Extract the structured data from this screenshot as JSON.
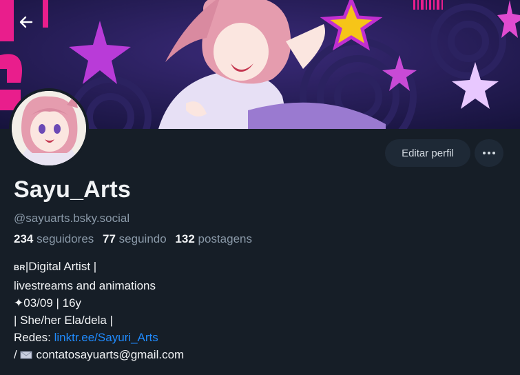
{
  "profile": {
    "display_name": "Sayu_Arts",
    "handle": "@sayuarts.bsky.social",
    "stats": {
      "followers_count": "234",
      "followers_label": "seguidores",
      "following_count": "77",
      "following_label": "seguindo",
      "posts_count": "132",
      "posts_label": "postagens"
    },
    "bio": {
      "line1_flag": "BR",
      "line1_text": "|Digital Artist |",
      "line2": "livestreams and animations",
      "line3": "✦03/09 | 16y",
      "line4": "| She/her Ela/dela |",
      "line5_label": "Redes: ",
      "line5_link": "linktr.ee/Sayuri_Arts",
      "line6_prefix": "/ ",
      "line6_email": "contatosayuarts@gmail.com"
    }
  },
  "actions": {
    "edit_label": "Editar perfil",
    "more_icon": "ellipsis-icon",
    "back_icon": "arrow-left-icon"
  },
  "colors": {
    "background": "#161e27",
    "button_bg": "#1e2936",
    "link": "#208bfe",
    "muted_text": "#8a99a8"
  }
}
